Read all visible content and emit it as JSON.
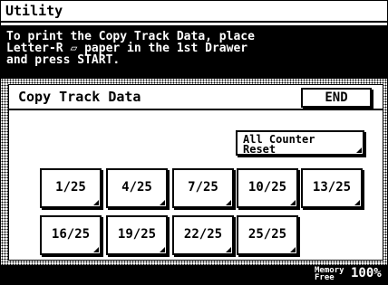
{
  "header": {
    "title": "Utility"
  },
  "message": {
    "lines": [
      "To print the Copy Track Data, place",
      "Letter-R ▱ paper in the 1st Drawer",
      "and press START."
    ]
  },
  "section": {
    "title": "Copy Track Data",
    "end_label": "END"
  },
  "reset_button": {
    "lines": [
      "All Counter",
      "Reset"
    ]
  },
  "counters": [
    "1/25",
    "4/25",
    "7/25",
    "10/25",
    "13/25",
    "16/25",
    "19/25",
    "22/25",
    "25/25"
  ],
  "status": {
    "memory_label": [
      "Memory",
      "Free"
    ],
    "memory_value": "100%"
  }
}
